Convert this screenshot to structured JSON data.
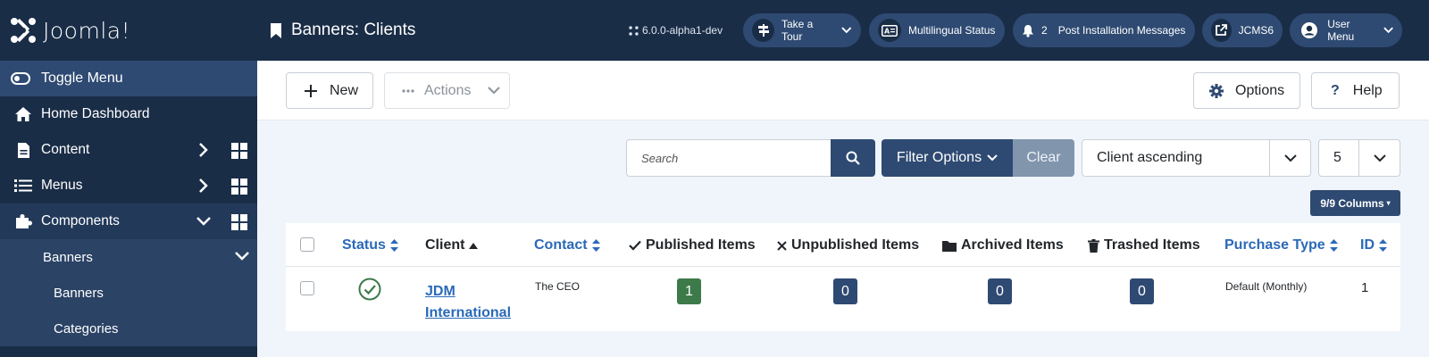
{
  "sidebar": {
    "logo_text": "Joomla!",
    "toggle_label": "Toggle Menu",
    "items": [
      {
        "label": "Home Dashboard",
        "icon": "home-icon"
      },
      {
        "label": "Content",
        "icon": "file-icon"
      },
      {
        "label": "Menus",
        "icon": "list-icon"
      },
      {
        "label": "Components",
        "icon": "puzzle-icon"
      }
    ],
    "sub_banners": "Banners",
    "subsub": [
      "Banners",
      "Categories"
    ]
  },
  "header": {
    "title": "Banners: Clients",
    "version": "6.0.0-alpha1-dev",
    "take_tour": "Take a Tour",
    "multilingual": "Multilingual Status",
    "post_count": "2",
    "post_install": "Post Installation Messages",
    "site": "JCMS6",
    "user_menu": "User Menu"
  },
  "toolbar": {
    "new": "New",
    "actions": "Actions",
    "options": "Options",
    "help": "Help"
  },
  "filters": {
    "search_placeholder": "Search",
    "filter_options": "Filter Options",
    "clear": "Clear",
    "ordering": "Client ascending",
    "limit": "5",
    "columns": "9/9 Columns"
  },
  "table": {
    "headers": {
      "status": "Status",
      "client": "Client",
      "contact": "Contact",
      "published": "Published Items",
      "unpublished": "Unpublished Items",
      "archived": "Archived Items",
      "trashed": "Trashed Items",
      "purchase_type": "Purchase Type",
      "id": "ID"
    },
    "rows": [
      {
        "client": "JDM International",
        "contact": "The CEO",
        "published": "1",
        "unpublished": "0",
        "archived": "0",
        "trashed": "0",
        "purchase_type": "Default (Monthly)",
        "id": "1"
      }
    ]
  },
  "colors": {
    "sidebar_bg": "#1a2d47",
    "accent": "#2e4a72",
    "link": "#2a69b8",
    "published_badge": "#3d7a4a",
    "count_badge": "#2e4a72"
  }
}
